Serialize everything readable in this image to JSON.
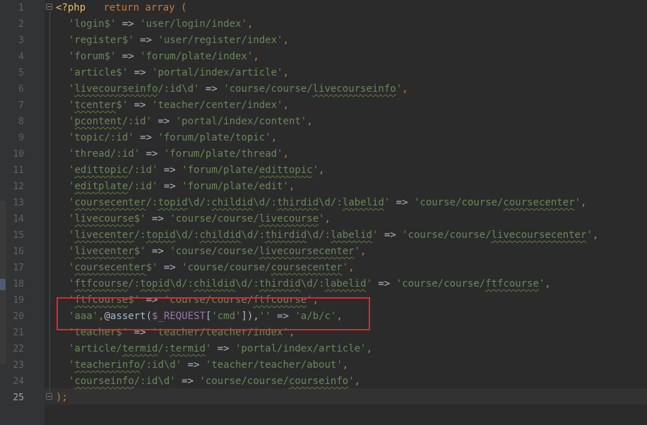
{
  "editor": {
    "current_line": 25,
    "line_numbers": [
      "1",
      "2",
      "3",
      "4",
      "5",
      "6",
      "7",
      "8",
      "9",
      "10",
      "11",
      "12",
      "13",
      "14",
      "15",
      "16",
      "17",
      "18",
      "19",
      "20",
      "21",
      "22",
      "23",
      "24",
      "25"
    ],
    "lines": [
      [
        {
          "t": "<?php",
          "c": "tag"
        },
        {
          "t": "   return array (",
          "c": "kw"
        }
      ],
      [
        {
          "t": "'login$'",
          "c": "s"
        },
        {
          "t": " => ",
          "c": "op"
        },
        {
          "t": "'user/login/index'",
          "c": "s"
        },
        {
          "t": ",",
          "c": "punct"
        }
      ],
      [
        {
          "t": "'register$'",
          "c": "s"
        },
        {
          "t": " => ",
          "c": "op"
        },
        {
          "t": "'user/register/index'",
          "c": "s"
        },
        {
          "t": ",",
          "c": "punct"
        }
      ],
      [
        {
          "t": "'forum$'",
          "c": "s"
        },
        {
          "t": " => ",
          "c": "op"
        },
        {
          "t": "'forum/plate/index'",
          "c": "s"
        },
        {
          "t": ",",
          "c": "punct"
        }
      ],
      [
        {
          "t": "'article$'",
          "c": "s"
        },
        {
          "t": " => ",
          "c": "op"
        },
        {
          "t": "'portal/index/article'",
          "c": "s"
        },
        {
          "t": ",",
          "c": "punct"
        }
      ],
      [
        {
          "t": "'",
          "c": "s"
        },
        {
          "t": "livecourseinfo",
          "c": "s u"
        },
        {
          "t": "/:id\\d'",
          "c": "s"
        },
        {
          "t": " => ",
          "c": "op"
        },
        {
          "t": "'course/course/",
          "c": "s"
        },
        {
          "t": "livecourseinfo",
          "c": "s u"
        },
        {
          "t": "'",
          "c": "s"
        },
        {
          "t": ",",
          "c": "punct"
        }
      ],
      [
        {
          "t": "'",
          "c": "s"
        },
        {
          "t": "tcenter",
          "c": "s u"
        },
        {
          "t": "$'",
          "c": "s"
        },
        {
          "t": " => ",
          "c": "op"
        },
        {
          "t": "'teacher/center/index'",
          "c": "s"
        },
        {
          "t": ",",
          "c": "punct"
        }
      ],
      [
        {
          "t": "'",
          "c": "s"
        },
        {
          "t": "pcontent",
          "c": "s u"
        },
        {
          "t": "/:id'",
          "c": "s"
        },
        {
          "t": " => ",
          "c": "op"
        },
        {
          "t": "'portal/index/content'",
          "c": "s"
        },
        {
          "t": ",",
          "c": "punct"
        }
      ],
      [
        {
          "t": "'topic/:id'",
          "c": "s"
        },
        {
          "t": " => ",
          "c": "op"
        },
        {
          "t": "'forum/plate/topic'",
          "c": "s"
        },
        {
          "t": ",",
          "c": "punct"
        }
      ],
      [
        {
          "t": "'thread/:id'",
          "c": "s"
        },
        {
          "t": " => ",
          "c": "op"
        },
        {
          "t": "'forum/plate/thread'",
          "c": "s"
        },
        {
          "t": ",",
          "c": "punct"
        }
      ],
      [
        {
          "t": "'",
          "c": "s"
        },
        {
          "t": "edittopic",
          "c": "s u"
        },
        {
          "t": "/:id'",
          "c": "s"
        },
        {
          "t": " => ",
          "c": "op"
        },
        {
          "t": "'forum/plate/",
          "c": "s"
        },
        {
          "t": "edittopic",
          "c": "s u"
        },
        {
          "t": "'",
          "c": "s"
        },
        {
          "t": ",",
          "c": "punct"
        }
      ],
      [
        {
          "t": "'",
          "c": "s"
        },
        {
          "t": "editplate",
          "c": "s u"
        },
        {
          "t": "/:id'",
          "c": "s"
        },
        {
          "t": " => ",
          "c": "op"
        },
        {
          "t": "'forum/plate/edit'",
          "c": "s"
        },
        {
          "t": ",",
          "c": "punct"
        }
      ],
      [
        {
          "t": "'",
          "c": "s"
        },
        {
          "t": "coursecenter",
          "c": "s u"
        },
        {
          "t": "/:",
          "c": "s"
        },
        {
          "t": "topid",
          "c": "s u"
        },
        {
          "t": "\\d/:",
          "c": "s"
        },
        {
          "t": "childid",
          "c": "s u"
        },
        {
          "t": "\\d/:",
          "c": "s"
        },
        {
          "t": "thirdid",
          "c": "s u"
        },
        {
          "t": "\\d/:",
          "c": "s"
        },
        {
          "t": "labelid",
          "c": "s u"
        },
        {
          "t": "'",
          "c": "s"
        },
        {
          "t": " => ",
          "c": "op"
        },
        {
          "t": "'course/course/",
          "c": "s"
        },
        {
          "t": "coursecenter",
          "c": "s u"
        },
        {
          "t": "'",
          "c": "s"
        },
        {
          "t": ",",
          "c": "punct"
        }
      ],
      [
        {
          "t": "'",
          "c": "s"
        },
        {
          "t": "livecourse",
          "c": "s u"
        },
        {
          "t": "$'",
          "c": "s"
        },
        {
          "t": " => ",
          "c": "op"
        },
        {
          "t": "'course/course/",
          "c": "s"
        },
        {
          "t": "livecourse",
          "c": "s u"
        },
        {
          "t": "'",
          "c": "s"
        },
        {
          "t": ",",
          "c": "punct"
        }
      ],
      [
        {
          "t": "'",
          "c": "s"
        },
        {
          "t": "livecenter",
          "c": "s u"
        },
        {
          "t": "/:",
          "c": "s"
        },
        {
          "t": "topid",
          "c": "s u"
        },
        {
          "t": "\\d/:",
          "c": "s"
        },
        {
          "t": "childid",
          "c": "s u"
        },
        {
          "t": "\\d/:",
          "c": "s"
        },
        {
          "t": "thirdid",
          "c": "s u"
        },
        {
          "t": "\\d/:",
          "c": "s"
        },
        {
          "t": "labelid",
          "c": "s u"
        },
        {
          "t": "'",
          "c": "s"
        },
        {
          "t": " => ",
          "c": "op"
        },
        {
          "t": "'course/course/",
          "c": "s"
        },
        {
          "t": "livecoursecenter",
          "c": "s u"
        },
        {
          "t": "'",
          "c": "s"
        },
        {
          "t": ",",
          "c": "punct"
        }
      ],
      [
        {
          "t": "'",
          "c": "s"
        },
        {
          "t": "livecenter",
          "c": "s u"
        },
        {
          "t": "$'",
          "c": "s"
        },
        {
          "t": " => ",
          "c": "op"
        },
        {
          "t": "'course/course/",
          "c": "s"
        },
        {
          "t": "livecoursecenter",
          "c": "s u"
        },
        {
          "t": "'",
          "c": "s"
        },
        {
          "t": ",",
          "c": "punct"
        }
      ],
      [
        {
          "t": "'",
          "c": "s"
        },
        {
          "t": "coursecenter",
          "c": "s u"
        },
        {
          "t": "$'",
          "c": "s"
        },
        {
          "t": " => ",
          "c": "op"
        },
        {
          "t": "'course/course/",
          "c": "s"
        },
        {
          "t": "coursecenter",
          "c": "s u"
        },
        {
          "t": "'",
          "c": "s"
        },
        {
          "t": ",",
          "c": "punct"
        }
      ],
      [
        {
          "t": "'",
          "c": "s"
        },
        {
          "t": "ftfcourse",
          "c": "s u"
        },
        {
          "t": "/:",
          "c": "s"
        },
        {
          "t": "topid",
          "c": "s u"
        },
        {
          "t": "\\d/:",
          "c": "s"
        },
        {
          "t": "childid",
          "c": "s u"
        },
        {
          "t": "\\d/:",
          "c": "s"
        },
        {
          "t": "thirdid",
          "c": "s u"
        },
        {
          "t": "\\d/:",
          "c": "s"
        },
        {
          "t": "labelid",
          "c": "s u"
        },
        {
          "t": "'",
          "c": "s"
        },
        {
          "t": " => ",
          "c": "op"
        },
        {
          "t": "'course/course/",
          "c": "s"
        },
        {
          "t": "ftfcourse",
          "c": "s u"
        },
        {
          "t": "'",
          "c": "s"
        },
        {
          "t": ",",
          "c": "punct"
        }
      ],
      [
        {
          "t": "'",
          "c": "s"
        },
        {
          "t": "ftfcourse",
          "c": "s u"
        },
        {
          "t": "$'",
          "c": "s"
        },
        {
          "t": " => ",
          "c": "op"
        },
        {
          "t": "'course/course/",
          "c": "s"
        },
        {
          "t": "ftfcourse",
          "c": "s u"
        },
        {
          "t": "'",
          "c": "s"
        },
        {
          "t": ",",
          "c": "punct"
        }
      ],
      [
        {
          "t": "'aaa'",
          "c": "s"
        },
        {
          "t": ",",
          "c": "punct"
        },
        {
          "t": "@assert(",
          "c": "op"
        },
        {
          "t": "$_REQUEST",
          "c": "var"
        },
        {
          "t": "[",
          "c": "op"
        },
        {
          "t": "'cmd'",
          "c": "s"
        },
        {
          "t": "]),",
          "c": "op"
        },
        {
          "t": "''",
          "c": "s"
        },
        {
          "t": " => ",
          "c": "op"
        },
        {
          "t": "'a/b/c'",
          "c": "s"
        },
        {
          "t": ",",
          "c": "punct"
        }
      ],
      [
        {
          "t": "'teacher$'",
          "c": "s"
        },
        {
          "t": " => ",
          "c": "op"
        },
        {
          "t": "'teacher/teacher/index'",
          "c": "s"
        },
        {
          "t": ",",
          "c": "punct"
        }
      ],
      [
        {
          "t": "'article/",
          "c": "s"
        },
        {
          "t": "termid",
          "c": "s u"
        },
        {
          "t": "/:",
          "c": "s"
        },
        {
          "t": "termid",
          "c": "s u"
        },
        {
          "t": "'",
          "c": "s"
        },
        {
          "t": " => ",
          "c": "op"
        },
        {
          "t": "'portal/index/article'",
          "c": "s"
        },
        {
          "t": ",",
          "c": "punct"
        }
      ],
      [
        {
          "t": "'",
          "c": "s"
        },
        {
          "t": "teacherinfo",
          "c": "s u"
        },
        {
          "t": "/:id\\d'",
          "c": "s"
        },
        {
          "t": " => ",
          "c": "op"
        },
        {
          "t": "'teacher/teacher/about'",
          "c": "s"
        },
        {
          "t": ",",
          "c": "punct"
        }
      ],
      [
        {
          "t": "'",
          "c": "s"
        },
        {
          "t": "courseinfo",
          "c": "s u"
        },
        {
          "t": "/:id\\d'",
          "c": "s"
        },
        {
          "t": " => ",
          "c": "op"
        },
        {
          "t": "'course/course/",
          "c": "s"
        },
        {
          "t": "courseinfo",
          "c": "s u"
        },
        {
          "t": "'",
          "c": "s"
        },
        {
          "t": ",",
          "c": "punct"
        }
      ],
      [
        {
          "t": ");",
          "c": "punct"
        }
      ]
    ],
    "colors": {
      "background": "#2b2b2b",
      "gutter": "#313335",
      "string": "#6a8759",
      "keyword": "#cc7832",
      "variable": "#9876aa",
      "highlight_box": "#e4252b"
    }
  }
}
